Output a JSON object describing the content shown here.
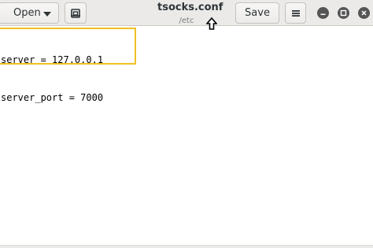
{
  "header": {
    "open_label": "Open",
    "title": "tsocks.conf",
    "subtitle": "/etc",
    "save_label": "Save",
    "icons": {
      "open_dropdown": "chevron-down-icon",
      "new_document": "new-document-icon",
      "menu": "hamburger-menu-icon",
      "minimize": "minimize-icon",
      "maximize": "maximize-icon",
      "close": "close-icon"
    }
  },
  "editor": {
    "lines": [
      "server = 127.0.0.1",
      "server_port = 7000"
    ],
    "highlight_color": "#f0c024"
  }
}
